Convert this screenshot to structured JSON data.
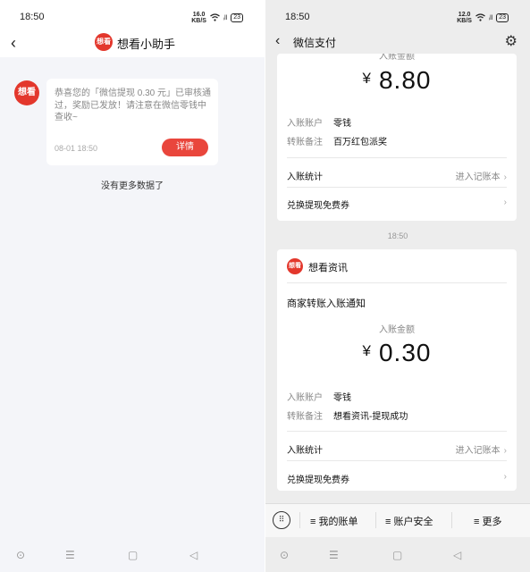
{
  "left": {
    "status": {
      "time": "18:50",
      "speed_top": "16.0",
      "speed_bottom": "KB/S",
      "signal": "ᵢll",
      "battery": "23"
    },
    "header": {
      "back": "‹",
      "logo": "想看",
      "title": "想看小助手"
    },
    "message": {
      "avatar": "想看",
      "text": "恭喜您的「微信提现 0.30 元」已审核通过，奖励已发放！请注意在微信零钱中查收~",
      "time": "08-01 18:50",
      "button": "详情"
    },
    "footer_text": "没有更多数据了",
    "nav": {
      "home": "⊙",
      "menu": "☰",
      "square": "▢",
      "back": "◁"
    }
  },
  "right": {
    "status": {
      "time": "18:50",
      "speed_top": "12.0",
      "speed_bottom": "KB/S",
      "signal": "ᵢll",
      "battery": "23"
    },
    "header": {
      "back": "‹",
      "title": "微信支付",
      "settings": "⚙"
    },
    "card1": {
      "amount_label_cut": "入账金额",
      "currency": "¥",
      "amount": "8.80",
      "account_key": "入账账户",
      "account_val": "零钱",
      "note_key": "转账备注",
      "note_val": "百万红包派奖",
      "stats_label": "入账统计",
      "stats_link": "进入记账本",
      "coupon_label": "兑换提现免费券",
      "chevron": "›"
    },
    "timestamp": "18:50",
    "card2": {
      "logo": "想看",
      "source": "想看资讯",
      "title": "商家转账入账通知",
      "amount_label": "入账金额",
      "currency": "¥",
      "amount": "0.30",
      "account_key": "入账账户",
      "account_val": "零钱",
      "note_key": "转账备注",
      "note_val": "想看资讯-提现成功",
      "stats_label": "入账统计",
      "stats_link": "进入记账本",
      "coupon_label": "兑换提现免费券",
      "chevron": "›"
    },
    "bottom_menu": {
      "keyboard": "⠿",
      "item1": "≡ 我的账单",
      "item2": "≡ 账户安全",
      "item3": "≡ 更多"
    },
    "nav": {
      "home": "⊙",
      "menu": "☰",
      "square": "▢",
      "back": "◁"
    }
  }
}
